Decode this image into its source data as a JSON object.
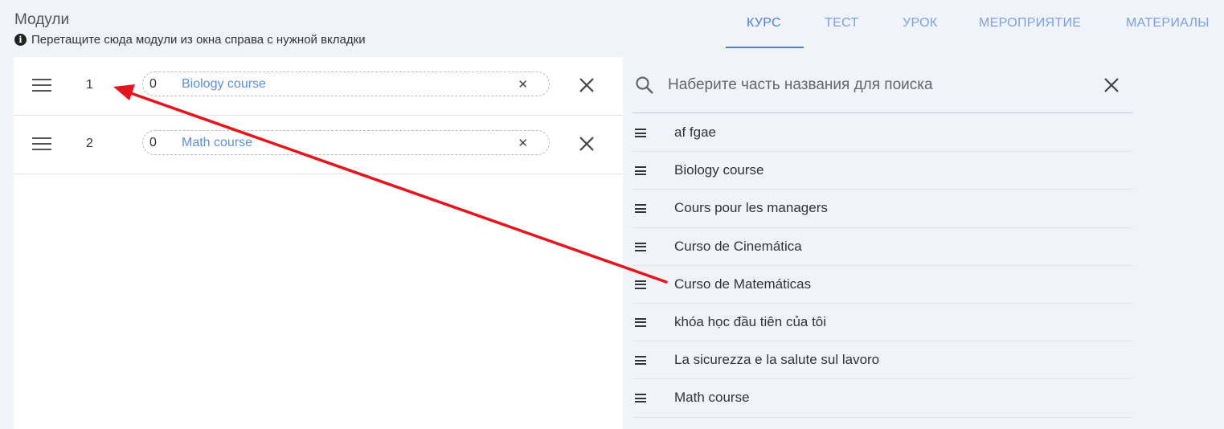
{
  "header": {
    "title": "Модули",
    "hint_icon": "info-icon",
    "hint": "Перетащите сюда модули из окна справа с нужной вкладки"
  },
  "tabs": [
    {
      "label": "КУРС",
      "active": true
    },
    {
      "label": "ТЕСТ",
      "active": false
    },
    {
      "label": "УРОК",
      "active": false
    },
    {
      "label": "МЕРОПРИЯТИЕ",
      "active": false
    },
    {
      "label": "МАТЕРИАЛЫ",
      "active": false
    }
  ],
  "modules": [
    {
      "number": "1",
      "prefix": "0",
      "label": "Biology course"
    },
    {
      "number": "2",
      "prefix": "0",
      "label": "Math course"
    }
  ],
  "search": {
    "placeholder": "Наберите часть названия для поиска",
    "value": ""
  },
  "courses": [
    {
      "label": "af fgae"
    },
    {
      "label": "Biology course"
    },
    {
      "label": "Cours pour les managers"
    },
    {
      "label": "Curso de Cinemática"
    },
    {
      "label": "Curso de Matemáticas"
    },
    {
      "label": "khóa học đầu tiên của tôi"
    },
    {
      "label": "La sicurezza e la salute sul lavoro"
    },
    {
      "label": "Math course"
    }
  ],
  "colors": {
    "accent": "#4a7fdc",
    "tab_inactive": "#7aa0e8",
    "link": "#5b8fe0",
    "annotation_arrow": "#e8141b",
    "background": "#f0f3f9"
  }
}
